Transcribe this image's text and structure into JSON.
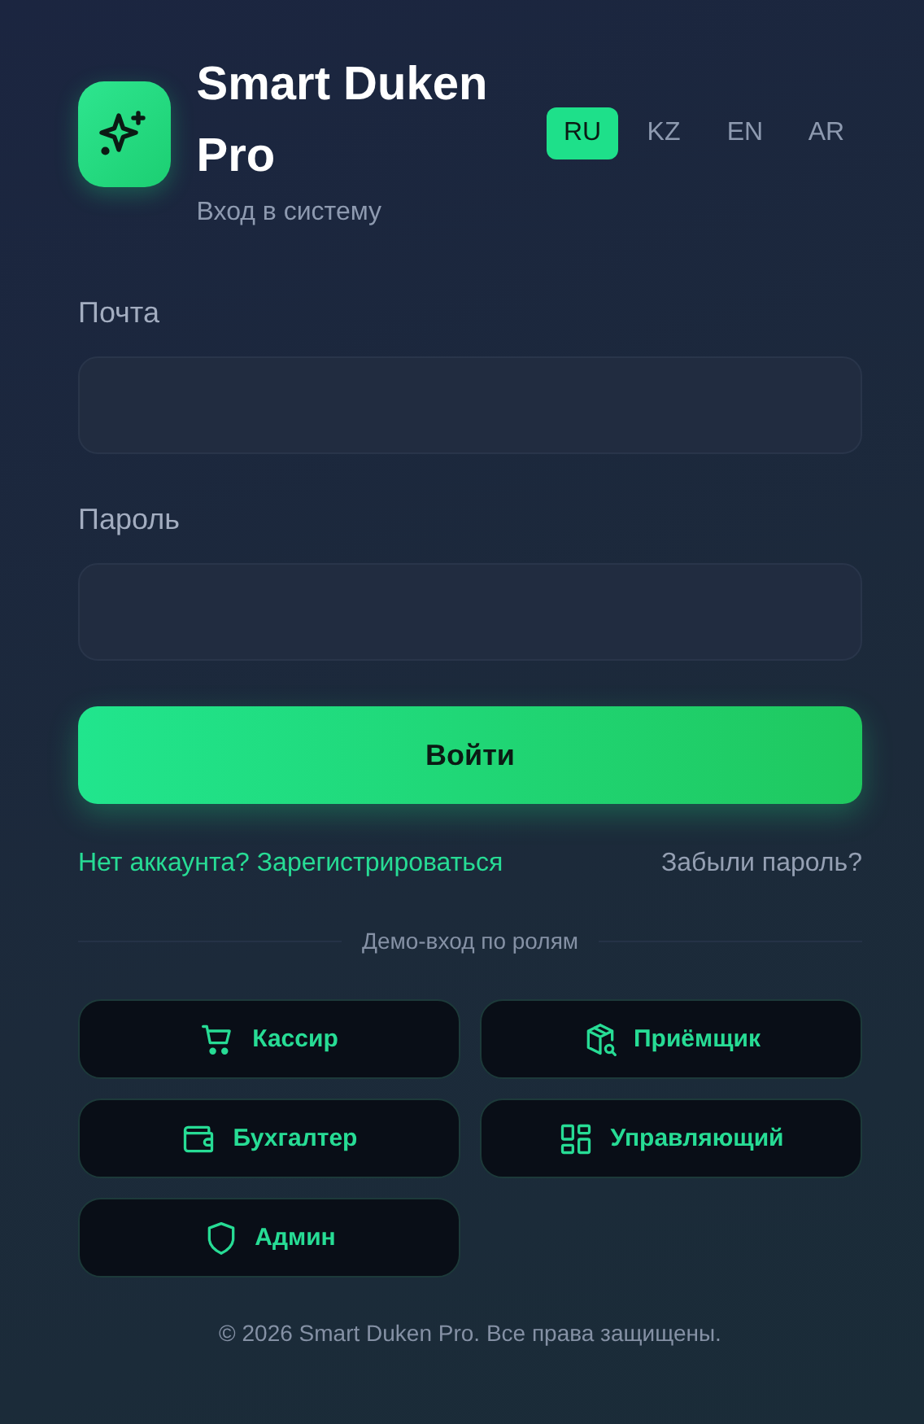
{
  "app": {
    "title": "Smart Duken Pro",
    "subtitle": "Вход в систему"
  },
  "languages": [
    {
      "label": "RU",
      "selected": true
    },
    {
      "label": "KZ",
      "selected": false
    },
    {
      "label": "EN",
      "selected": false
    },
    {
      "label": "AR",
      "selected": false
    }
  ],
  "form": {
    "email_label": "Почта",
    "password_label": "Пароль",
    "submit": "Войти"
  },
  "links": {
    "register": "Нет аккаунта? Зарегистрироваться",
    "forgot": "Забыли пароль?"
  },
  "demo": {
    "heading": "Демо-вход по ролям",
    "roles": [
      {
        "label": "Кассир",
        "kind": "cart"
      },
      {
        "label": "Приёмщик",
        "kind": "package"
      },
      {
        "label": "Бухгалтер",
        "kind": "wallet"
      },
      {
        "label": "Управляющий",
        "kind": "grid"
      },
      {
        "label": "Админ",
        "kind": "shield"
      }
    ]
  },
  "footer": "© 2026 Smart Duken Pro. Все права защищены."
}
